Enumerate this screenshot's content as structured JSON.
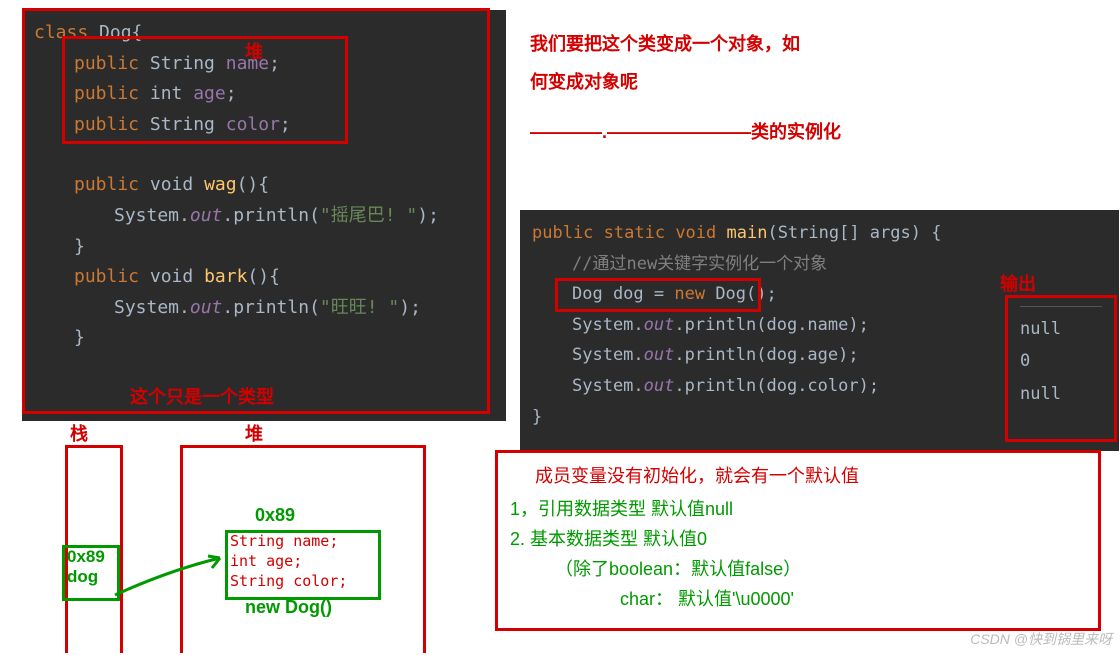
{
  "code_left": {
    "l1_kw": "class",
    "l1_name": " Dog{",
    "l2_kw": "public",
    "l2_type": " String ",
    "l2_name": "name",
    "l2_end": ";",
    "l3_kw": "public",
    "l3_type": " int ",
    "l3_name": "age",
    "l3_end": ";",
    "l4_kw": "public",
    "l4_type": " String ",
    "l4_name": "color",
    "l4_end": ";",
    "l5_kw": "public",
    "l5_type": " void ",
    "l5_name": "wag",
    "l5_end": "(){",
    "l6_pre": "System.",
    "l6_out": "out",
    "l6_mid": ".println(",
    "l6_str": "\"摇尾巴! \"",
    "l6_end": ");",
    "l7": "}",
    "l8_kw": "public",
    "l8_type": " void ",
    "l8_name": "bark",
    "l8_end": "(){",
    "l9_pre": "System.",
    "l9_out": "out",
    "l9_mid": ".println(",
    "l9_str": "\"旺旺! \"",
    "l9_end": ");",
    "l10": "}"
  },
  "label_heap1": "堆",
  "annotation_q1": "我们要把这个类变成一个对象，如",
  "annotation_q2": "何变成对象呢",
  "annotation_dash": "————.————————类的实例化",
  "just_type": "这个只是一个类型",
  "stack_label": "栈",
  "heap_label2": "堆",
  "stack_box": {
    "addr": "0x89",
    "name": "dog"
  },
  "heap_box": {
    "addr": "0x89",
    "f1": "String name;",
    "f2": "int age;",
    "f3": "String color;",
    "label": "new Dog()"
  },
  "code_right": {
    "l1_kw1": "public",
    "l1_kw2": " static",
    "l1_kw3": " void ",
    "l1_name": "main",
    "l1_rest": "(String[] args) {",
    "l2_comment": "//通过new关键字实例化一个对象",
    "l3_pre": "Dog dog = ",
    "l3_kw": "new",
    "l3_end": " Dog();",
    "l4_pre": "System.",
    "l4_out": "out",
    "l4_mid": ".println(dog.name);",
    "l5_pre": "System.",
    "l5_out": "out",
    "l5_mid": ".println(dog.age);",
    "l6_pre": "System.",
    "l6_out": "out",
    "l6_mid": ".println(dog.color);",
    "l7": "}"
  },
  "output_label": "输出",
  "output": {
    "l1": "null",
    "l2": "0",
    "l3": "null"
  },
  "defaults": {
    "title": "成员变量没有初始化，就会有一个默认值",
    "l1": "1，引用数据类型 默认值null",
    "l2": "2. 基本数据类型 默认值0",
    "l3": "（除了boolean：默认值false）",
    "l4": "char：   默认值'\\u0000'"
  },
  "watermark": "CSDN @快到锅里来呀"
}
